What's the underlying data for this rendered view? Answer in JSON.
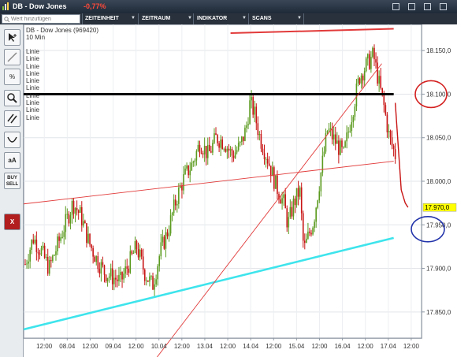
{
  "window": {
    "title": "DB - Dow Jones",
    "change": "-0,77%"
  },
  "toolbar": {
    "search_placeholder": "Wert hinzufügen",
    "menus": [
      "ZEITEINHEIT",
      "ZEITRAUM",
      "INDIKATOR",
      "SCANS"
    ]
  },
  "palette": {
    "tools": [
      {
        "icon": "cursor-icon"
      },
      {
        "icon": "line-tool-icon"
      },
      {
        "icon": "percent-icon",
        "label": "%"
      },
      {
        "icon": "zoom-icon"
      },
      {
        "icon": "parallel-lines-icon"
      },
      {
        "icon": "arc-icon"
      },
      {
        "icon": "text-tool-icon",
        "label": "aA"
      },
      {
        "icon": "buy-sell-icon",
        "label": "BUY SELL"
      },
      {
        "icon": "delete-icon",
        "label": "X"
      }
    ]
  },
  "chart_header": {
    "name": "DB - Dow Jones (969420)",
    "interval": "10 Min",
    "studies": [
      "Linie",
      "Linie",
      "Linie",
      "Linie",
      "Linie",
      "Linie",
      "Linie",
      "Linie",
      "Linie",
      "Linie"
    ]
  },
  "chart_data": {
    "type": "candlestick",
    "x_ticks": [
      "12:00",
      "08.04",
      "12:00",
      "09.04",
      "12:00",
      "10.04",
      "12:00",
      "13.04",
      "12:00",
      "14.04",
      "12:00",
      "15.04",
      "12:00",
      "16.04",
      "12:00",
      "17.04",
      "12:00"
    ],
    "y_ticks": [
      "18.150,0",
      "18.100,0",
      "18.050,0",
      "18.000,0",
      "17.950,0",
      "17.900,0",
      "17.850,0"
    ],
    "ylim": [
      17820,
      18180
    ],
    "last_price": "17.970,0",
    "grid": true,
    "colors": {
      "up": "#5a9a1e",
      "down": "#c81414",
      "support": "#3ee4ec",
      "resistance_h": "#000000",
      "red_line": "#e23a3a",
      "circle_red": "#d42020",
      "circle_blue": "#2233aa"
    },
    "price_path": [
      [
        0,
        17905
      ],
      [
        0.02,
        17935
      ],
      [
        0.04,
        17920
      ],
      [
        0.06,
        17900
      ],
      [
        0.08,
        17925
      ],
      [
        0.1,
        17950
      ],
      [
        0.12,
        17975
      ],
      [
        0.14,
        17960
      ],
      [
        0.16,
        17930
      ],
      [
        0.18,
        17910
      ],
      [
        0.2,
        17895
      ],
      [
        0.22,
        17890
      ],
      [
        0.24,
        17885
      ],
      [
        0.26,
        17905
      ],
      [
        0.28,
        17925
      ],
      [
        0.3,
        17895
      ],
      [
        0.32,
        17880
      ],
      [
        0.34,
        17920
      ],
      [
        0.36,
        17945
      ],
      [
        0.38,
        17980
      ],
      [
        0.4,
        18005
      ],
      [
        0.42,
        18020
      ],
      [
        0.44,
        18045
      ],
      [
        0.46,
        18030
      ],
      [
        0.48,
        18050
      ],
      [
        0.5,
        18045
      ],
      [
        0.52,
        18030
      ],
      [
        0.54,
        18040
      ],
      [
        0.555,
        18060
      ],
      [
        0.565,
        18090
      ],
      [
        0.575,
        18080
      ],
      [
        0.59,
        18050
      ],
      [
        0.61,
        18025
      ],
      [
        0.63,
        17995
      ],
      [
        0.65,
        17975
      ],
      [
        0.66,
        17950
      ],
      [
        0.675,
        17975
      ],
      [
        0.69,
        17990
      ],
      [
        0.7,
        17920
      ],
      [
        0.71,
        17935
      ],
      [
        0.725,
        17955
      ],
      [
        0.74,
        18000
      ],
      [
        0.76,
        18060
      ],
      [
        0.78,
        18045
      ],
      [
        0.8,
        18030
      ],
      [
        0.82,
        18075
      ],
      [
        0.84,
        18120
      ],
      [
        0.86,
        18135
      ],
      [
        0.875,
        18145
      ],
      [
        0.89,
        18110
      ],
      [
        0.9,
        18090
      ],
      [
        0.915,
        18050
      ],
      [
        0.93,
        18030
      ],
      [
        0.945,
        18075
      ],
      [
        0.96,
        18100
      ],
      [
        0.975,
        18160
      ],
      [
        0.985,
        18150
      ],
      [
        0.992,
        18090
      ],
      [
        1.0,
        18070
      ]
    ],
    "price_tail": [
      [
        0.93,
        18090
      ],
      [
        0.945,
        17990
      ],
      [
        0.955,
        17975
      ],
      [
        0.962,
        17970
      ]
    ],
    "lines": [
      {
        "name": "Linie",
        "type": "support",
        "from": [
          0,
          17830
        ],
        "to": [
          0.93,
          17935
        ]
      },
      {
        "name": "Linie",
        "type": "resistance",
        "from": [
          0.52,
          18170
        ],
        "to": [
          0.93,
          18175
        ]
      },
      {
        "name": "Linie",
        "type": "horizontal",
        "from": [
          0,
          18100
        ],
        "to": [
          0.93,
          18100
        ]
      },
      {
        "name": "Linie",
        "type": "trend-thin",
        "from": [
          0,
          17974
        ],
        "to": [
          0.93,
          18023
        ]
      },
      {
        "name": "Linie",
        "type": "trend-steep",
        "from": [
          0.33,
          17795
        ],
        "to": [
          0.9,
          18135
        ]
      }
    ]
  }
}
